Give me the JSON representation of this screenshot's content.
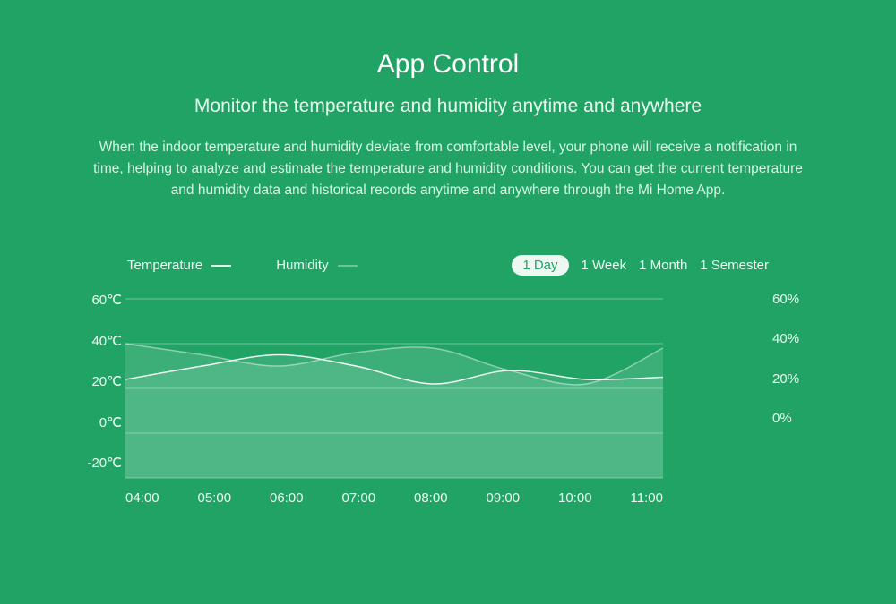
{
  "header": {
    "title": "App Control",
    "subtitle": "Monitor the temperature and humidity anytime and anywhere",
    "description": "When the indoor temperature and humidity deviate from comfortable level, your phone will receive a notification in time, helping to analyze and estimate the temperature and humidity conditions. You can get the current temperature and humidity data and historical records anytime and anywhere through the Mi Home App."
  },
  "legend": {
    "temperature": "Temperature",
    "humidity": "Humidity"
  },
  "ranges": {
    "selected": "1 Day",
    "items": [
      "1 Day",
      "1 Week",
      "1 Month",
      "1 Semester"
    ]
  },
  "chart_data": {
    "type": "line",
    "x": [
      "04:00",
      "05:00",
      "06:00",
      "07:00",
      "08:00",
      "09:00",
      "10:00",
      "11:00"
    ],
    "series": [
      {
        "name": "Temperature",
        "unit": "℃",
        "axis": "left",
        "values": [
          24,
          30,
          35,
          30,
          22,
          28,
          24,
          25
        ]
      },
      {
        "name": "Humidity",
        "unit": "%",
        "axis": "right",
        "values": [
          40,
          35,
          30,
          36,
          38,
          28,
          22,
          38
        ]
      }
    ],
    "left_axis": {
      "label": "℃",
      "ticks": [
        60,
        40,
        20,
        0,
        -20
      ],
      "min": -20,
      "max": 60
    },
    "right_axis": {
      "label": "%",
      "ticks": [
        60,
        40,
        20,
        0
      ],
      "min": -20,
      "max": 60
    },
    "grid": true
  }
}
